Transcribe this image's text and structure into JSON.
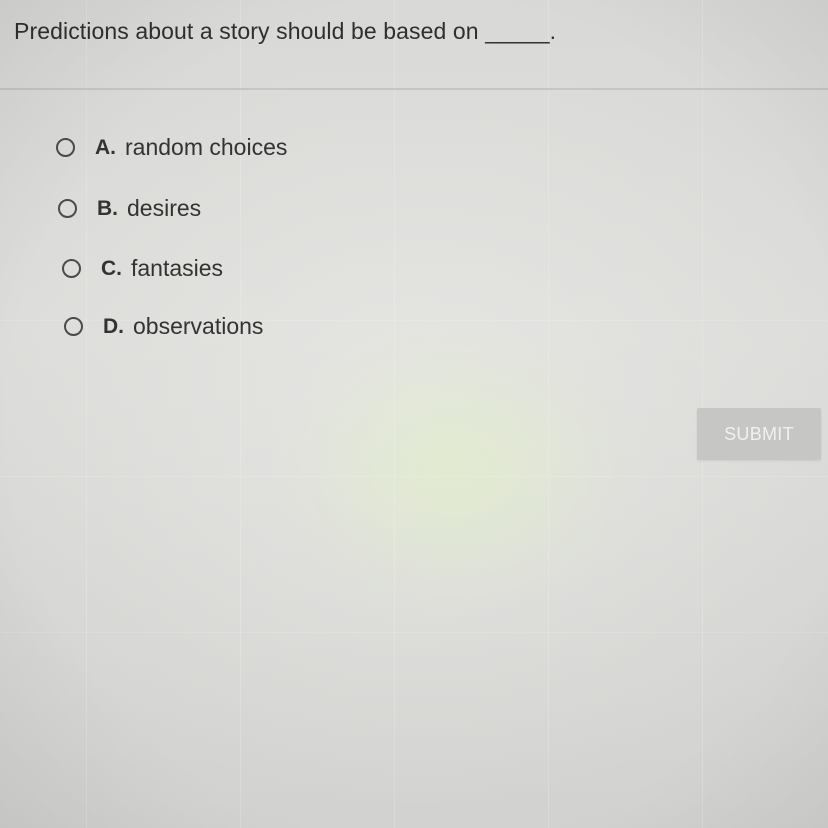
{
  "question": {
    "text": "Predictions about a story should be based on _____."
  },
  "options": [
    {
      "letter": "A.",
      "text": "random choices",
      "selected": false
    },
    {
      "letter": "B.",
      "text": "desires",
      "selected": false
    },
    {
      "letter": "C.",
      "text": "fantasies",
      "selected": false
    },
    {
      "letter": "D.",
      "text": "observations",
      "selected": false
    }
  ],
  "submit": {
    "label": "SUBMIT",
    "enabled": false
  },
  "colors": {
    "background": "#d9d9d7",
    "text": "#2f2f2f",
    "button_disabled": "#c6c6c4",
    "button_text": "#f1f1ef"
  }
}
